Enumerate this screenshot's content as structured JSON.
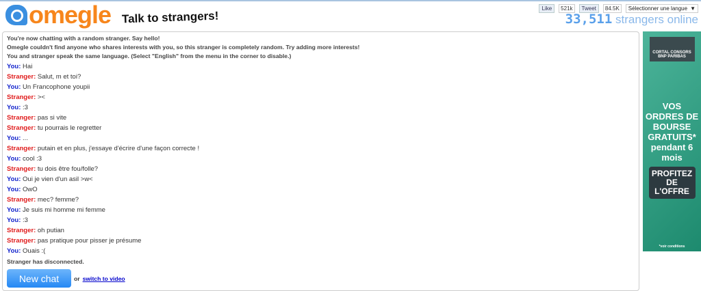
{
  "header": {
    "logo": "omegle",
    "tagline": "Talk to strangers!",
    "like": "Like",
    "like_count": "521k",
    "tweet": "Tweet",
    "tweet_count": "84.5K",
    "language": "Sélectionner une langue",
    "online_count": "33,511",
    "online_label": "strangers online"
  },
  "system": [
    "You're now chatting with a random stranger. Say hello!",
    "Omegle couldn't find anyone who shares interests with you, so this stranger is completely random. Try adding more interests!",
    "You and stranger speak the same language. (Select \"English\" from the menu in the corner to disable.)"
  ],
  "messages": [
    {
      "who": "You:",
      "text": "Hai"
    },
    {
      "who": "Stranger:",
      "text": "Salut, m et toi?"
    },
    {
      "who": "You:",
      "text": "Un Francophone youpii"
    },
    {
      "who": "Stranger:",
      "text": "><"
    },
    {
      "who": "You:",
      "text": ":3"
    },
    {
      "who": "Stranger:",
      "text": "pas si vite"
    },
    {
      "who": "Stranger:",
      "text": "tu pourrais le regretter"
    },
    {
      "who": "You:",
      "text": "..."
    },
    {
      "who": "Stranger:",
      "text": "putain et en plus, j'essaye d'écrire d'une façon correcte !"
    },
    {
      "who": "You:",
      "text": "cool :3"
    },
    {
      "who": "Stranger:",
      "text": "tu dois être fou/folle?"
    },
    {
      "who": "You:",
      "text": "Oui je vien d'un asil >w<"
    },
    {
      "who": "You:",
      "text": "OwO"
    },
    {
      "who": "Stranger:",
      "text": "mec? femme?"
    },
    {
      "who": "You:",
      "text": "Je suis mi homme mi femme"
    },
    {
      "who": "You:",
      "text": ":3"
    },
    {
      "who": "Stranger:",
      "text": "oh putian"
    },
    {
      "who": "Stranger:",
      "text": "pas pratique pour pisser je présume"
    },
    {
      "who": "You:",
      "text": "Ouais :("
    }
  ],
  "disconnected": "Stranger has disconnected.",
  "new_chat": "New chat",
  "or": "or",
  "switch_video": "switch to video",
  "ad": {
    "brand": "CORTAL CONSORS BNP PARIBAS",
    "text": "VOS ORDRES DE BOURSE GRATUITS* pendant 6 mois",
    "button": "PROFITEZ DE L'OFFRE",
    "conditions": "*voir conditions"
  }
}
